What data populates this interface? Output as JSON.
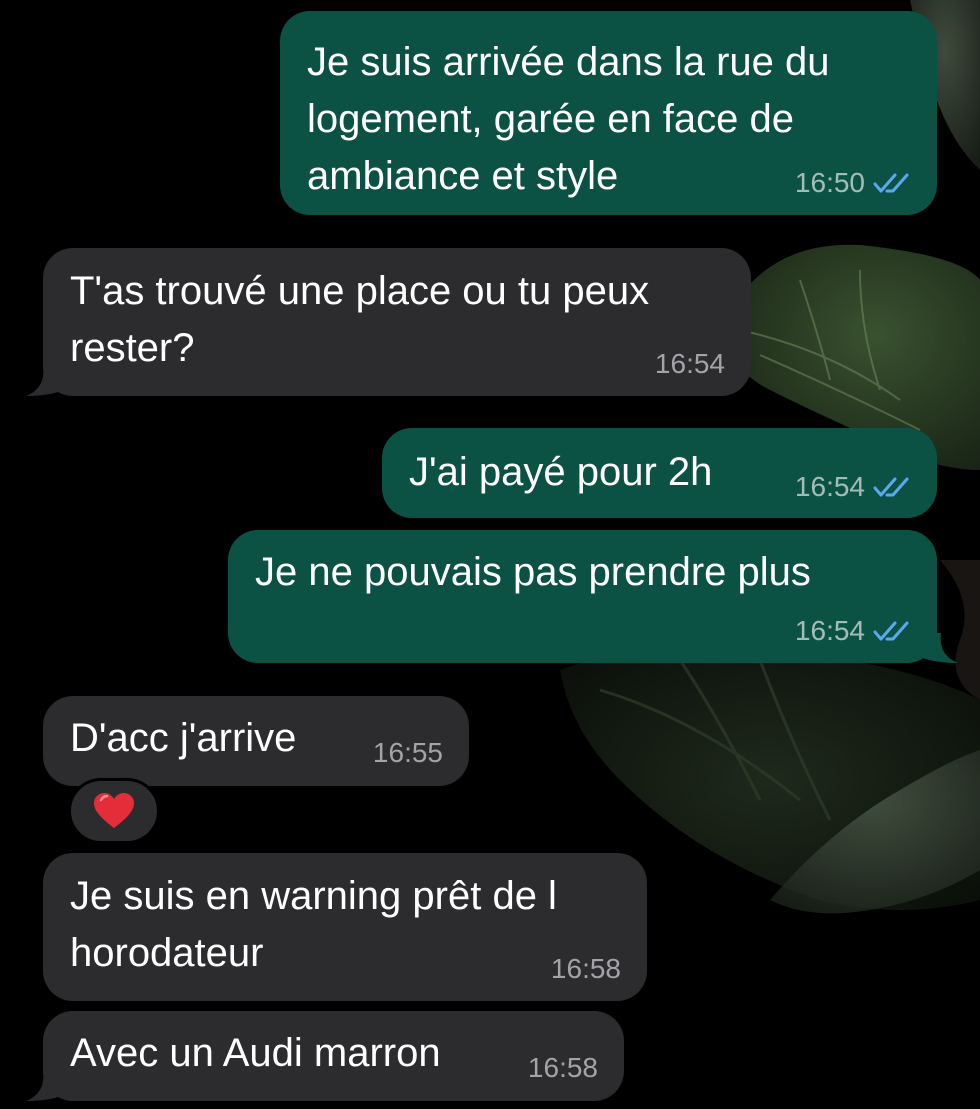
{
  "conversation": {
    "messages": [
      {
        "direction": "outgoing",
        "lines": [
          "Je suis arrivée dans la rue du",
          "logement, garée en face de",
          "ambiance et style"
        ],
        "time": "16:50",
        "status": "read"
      },
      {
        "direction": "incoming",
        "lines": [
          "T'as trouvé une place ou tu peux",
          "rester?"
        ],
        "time": "16:54"
      },
      {
        "direction": "outgoing",
        "lines": [
          "J'ai payé pour 2h"
        ],
        "time": "16:54",
        "status": "read"
      },
      {
        "direction": "outgoing",
        "lines": [
          "Je ne pouvais pas prendre plus"
        ],
        "time": "16:54",
        "status": "read"
      },
      {
        "direction": "incoming",
        "lines": [
          "D'acc j'arrive"
        ],
        "time": "16:55",
        "reaction": "heart-emoji"
      },
      {
        "direction": "incoming",
        "lines": [
          "Je suis en warning prêt de l",
          "horodateur"
        ],
        "time": "16:58"
      },
      {
        "direction": "incoming",
        "lines": [
          "Avec un Audi marron"
        ],
        "time": "16:58"
      }
    ]
  },
  "colors": {
    "outgoing_bubble": "#0c5244",
    "incoming_bubble": "#2c2c2e",
    "read_ticks": "#5aa9f0",
    "background": "#000000"
  },
  "icons": {
    "read_status": "double-check-icon",
    "reaction": "heart-emoji",
    "wallpaper": "fig-leaves-wallpaper"
  }
}
